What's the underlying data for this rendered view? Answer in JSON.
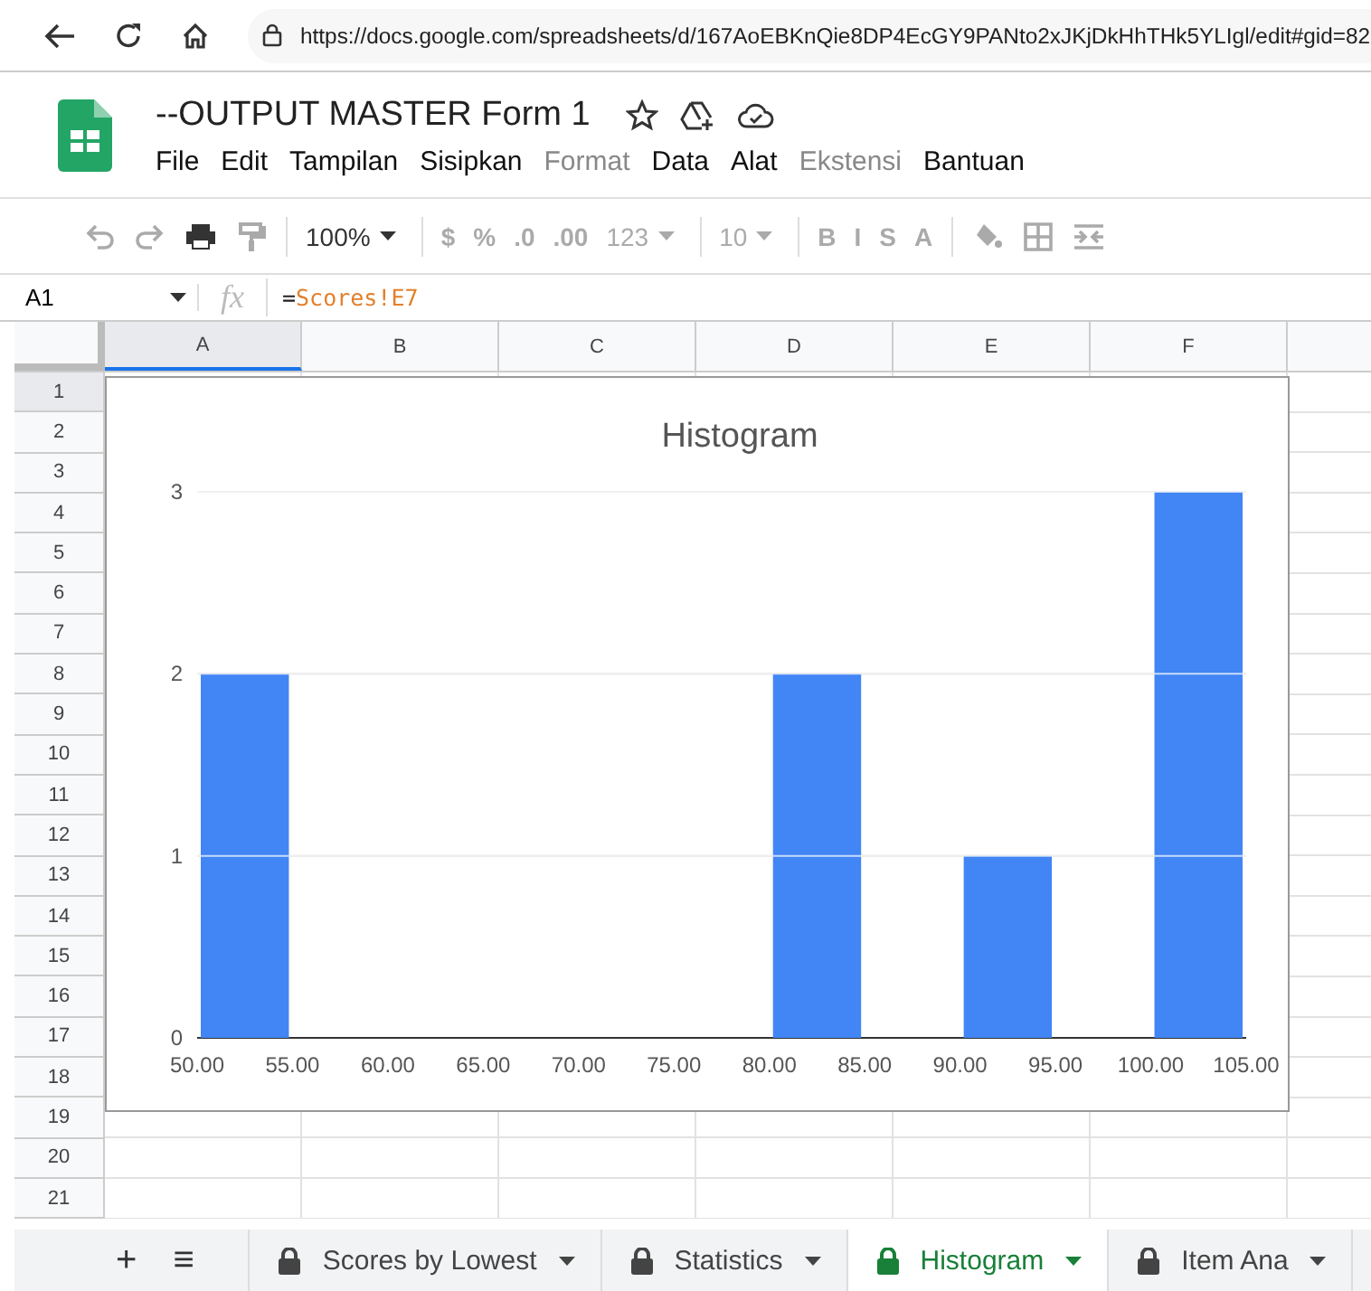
{
  "browser": {
    "url": "https://docs.google.com/spreadsheets/d/167AoEBKnQie8DP4EcGY9PANto2xJKjDkHhTHk5YLIgl/edit#gid=82"
  },
  "document": {
    "title": "--OUTPUT MASTER Form 1"
  },
  "menu": [
    {
      "label": "File",
      "disabled": false
    },
    {
      "label": "Edit",
      "disabled": false
    },
    {
      "label": "Tampilan",
      "disabled": false
    },
    {
      "label": "Sisipkan",
      "disabled": false
    },
    {
      "label": "Format",
      "disabled": true
    },
    {
      "label": "Data",
      "disabled": false
    },
    {
      "label": "Alat",
      "disabled": false
    },
    {
      "label": "Ekstensi",
      "disabled": true
    },
    {
      "label": "Bantuan",
      "disabled": false
    }
  ],
  "toolbar": [
    {
      "kind": "undo",
      "disabled": true
    },
    {
      "kind": "redo",
      "disabled": true
    },
    {
      "kind": "print",
      "disabled": false
    },
    {
      "kind": "paint",
      "disabled": true
    },
    {
      "kind": "sep"
    },
    {
      "kind": "dropdown",
      "label": "100%",
      "disabled": false
    },
    {
      "kind": "sep"
    },
    {
      "kind": "text",
      "label": "$",
      "disabled": true
    },
    {
      "kind": "text",
      "label": "%",
      "disabled": true
    },
    {
      "kind": "text",
      "label": ".0",
      "disabled": true
    },
    {
      "kind": "text",
      "label": ".00",
      "disabled": true
    },
    {
      "kind": "dropdown",
      "label": "123",
      "disabled": true
    },
    {
      "kind": "sep"
    },
    {
      "kind": "dropdown",
      "label": "10",
      "disabled": true
    },
    {
      "kind": "sep"
    },
    {
      "kind": "text",
      "label": "B",
      "disabled": true
    },
    {
      "kind": "text",
      "label": "I",
      "disabled": true
    },
    {
      "kind": "text",
      "label": "S",
      "disabled": true
    },
    {
      "kind": "text",
      "label": "A",
      "disabled": true
    },
    {
      "kind": "sep"
    },
    {
      "kind": "fill",
      "disabled": true
    },
    {
      "kind": "borders",
      "disabled": true
    },
    {
      "kind": "merge",
      "disabled": true
    }
  ],
  "formula_bar": {
    "cell": "A1",
    "fx": "fx",
    "formula_prefix": "=",
    "formula_ref": "Scores!E7"
  },
  "columns": [
    {
      "label": "A",
      "selected": true
    },
    {
      "label": "B",
      "selected": false
    },
    {
      "label": "C",
      "selected": false
    },
    {
      "label": "D",
      "selected": false
    },
    {
      "label": "E",
      "selected": false
    },
    {
      "label": "F",
      "selected": false
    }
  ],
  "rows": [
    {
      "label": "1",
      "selected": true
    },
    {
      "label": "2",
      "selected": false
    },
    {
      "label": "3",
      "selected": false
    },
    {
      "label": "4",
      "selected": false
    },
    {
      "label": "5",
      "selected": false
    },
    {
      "label": "6",
      "selected": false
    },
    {
      "label": "7",
      "selected": false
    },
    {
      "label": "8",
      "selected": false
    },
    {
      "label": "9",
      "selected": false
    },
    {
      "label": "10",
      "selected": false
    },
    {
      "label": "11",
      "selected": false
    },
    {
      "label": "12",
      "selected": false
    },
    {
      "label": "13",
      "selected": false
    },
    {
      "label": "14",
      "selected": false
    },
    {
      "label": "15",
      "selected": false
    },
    {
      "label": "16",
      "selected": false
    },
    {
      "label": "17",
      "selected": false
    },
    {
      "label": "18",
      "selected": false
    },
    {
      "label": "19",
      "selected": false
    },
    {
      "label": "20",
      "selected": false
    },
    {
      "label": "21",
      "selected": false
    }
  ],
  "chart": {
    "chart_data": {
      "type": "bar",
      "title": "Histogram",
      "grid": true,
      "x": [
        52.5,
        57.5,
        62.5,
        67.5,
        72.5,
        77.5,
        82.5,
        87.5,
        92.5,
        97.5,
        102.5
      ],
      "values": [
        2,
        0,
        0,
        0,
        0,
        0,
        2,
        0,
        1,
        0,
        3
      ],
      "xlim": [
        50,
        105
      ],
      "ylim": [
        0,
        3
      ],
      "xticks": [
        {
          "value": 50,
          "label": "50.00"
        },
        {
          "value": 55,
          "label": "55.00"
        },
        {
          "value": 60,
          "label": "60.00"
        },
        {
          "value": 65,
          "label": "65.00"
        },
        {
          "value": 70,
          "label": "70.00"
        },
        {
          "value": 75,
          "label": "75.00"
        },
        {
          "value": 80,
          "label": "80.00"
        },
        {
          "value": 85,
          "label": "85.00"
        },
        {
          "value": 90,
          "label": "90.00"
        },
        {
          "value": 95,
          "label": "95.00"
        },
        {
          "value": 100,
          "label": "100.00"
        },
        {
          "value": 105,
          "label": "105.00"
        }
      ],
      "yticks": [
        0,
        1,
        2,
        3
      ]
    }
  },
  "sheet_tabs": {
    "add": "+",
    "list": "≡",
    "tabs": [
      {
        "label": "Scores by Lowest",
        "selected": false
      },
      {
        "label": "Statistics",
        "selected": false
      },
      {
        "label": "Histogram",
        "selected": true
      },
      {
        "label": "Item Ana",
        "selected": false
      }
    ]
  }
}
